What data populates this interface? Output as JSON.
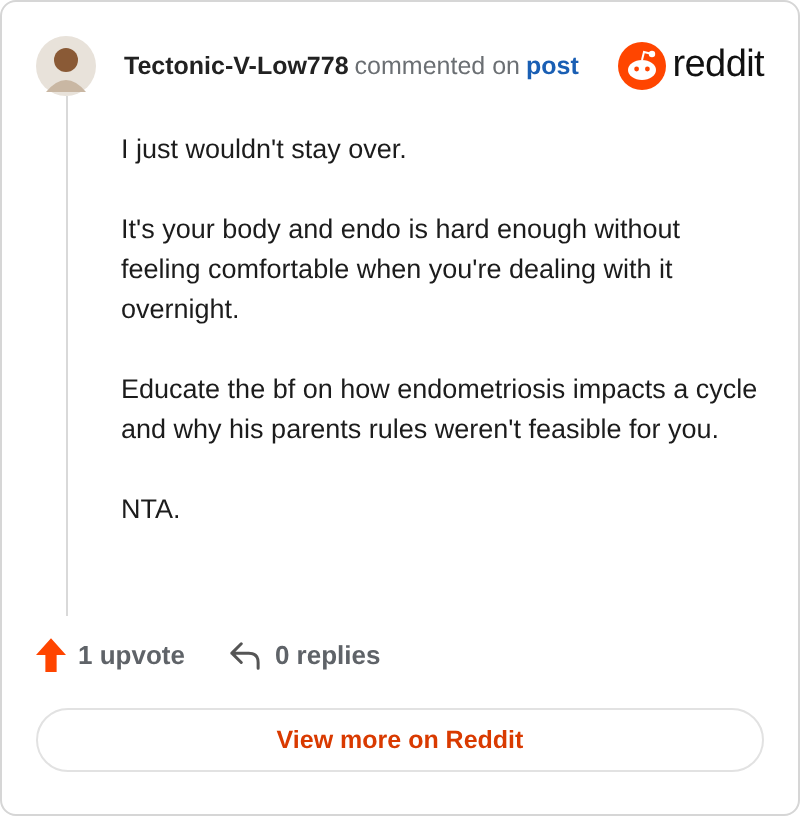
{
  "comment": {
    "author": "Tectonic-V-Low778",
    "action": "commented on",
    "target": "post",
    "brand": "reddit",
    "paragraphs": [
      "I just wouldn't stay over.",
      "It's your body and endo is hard enough without feeling comfortable when you're dealing with it overnight.",
      "Educate the bf on how endometriosis impacts a cycle and why his parents rules weren't feasible for you.",
      "NTA."
    ],
    "upvotes": "1 upvote",
    "replies": "0 replies"
  },
  "button": "View more on Reddit"
}
